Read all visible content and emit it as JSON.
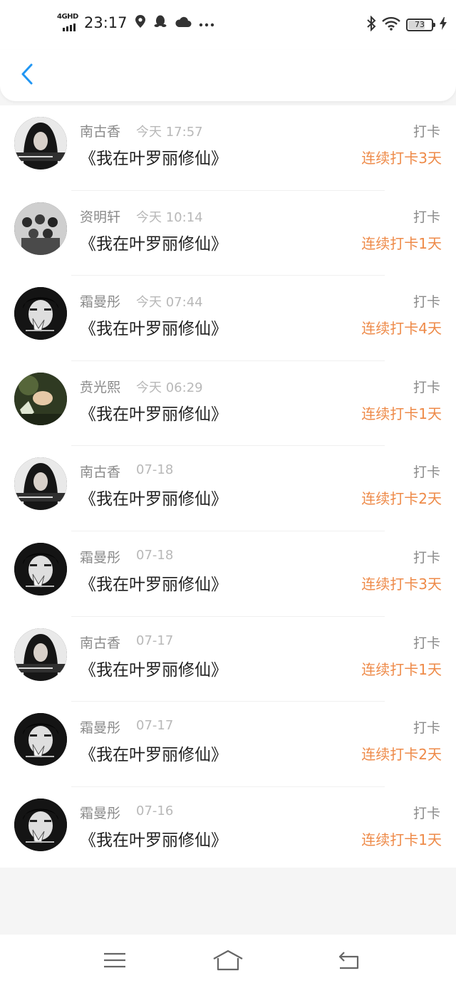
{
  "status_bar": {
    "network_label": "4GHD",
    "time": "23:17",
    "battery": "73",
    "battery_level_percent": 73,
    "icons": [
      "network-icon",
      "location-icon",
      "qq-icon",
      "cloud-icon",
      "more-dots-icon",
      "bluetooth-icon",
      "wifi-icon",
      "battery-icon",
      "charging-icon"
    ]
  },
  "header": {
    "back_icon": "chevron-left-icon",
    "accent_color": "#2196F3"
  },
  "feed": {
    "streak_color": "#EE8A48",
    "items": [
      {
        "name": "南古香",
        "time": "今天 17:57",
        "book": "《我在叶罗丽修仙》",
        "action": "打卡",
        "streak": "连续打卡3天",
        "avatar": "avatar-woman-dark-hair"
      },
      {
        "name": "资明轩",
        "time": "今天 10:14",
        "book": "《我在叶罗丽修仙》",
        "action": "打卡",
        "streak": "连续打卡1天",
        "avatar": "avatar-group-photo"
      },
      {
        "name": "霜曼彤",
        "time": "今天 07:44",
        "book": "《我在叶罗丽修仙》",
        "action": "打卡",
        "streak": "连续打卡4天",
        "avatar": "avatar-boy-bw"
      },
      {
        "name": "贲光熙",
        "time": "今天 06:29",
        "book": "《我在叶罗丽修仙》",
        "action": "打卡",
        "streak": "连续打卡1天",
        "avatar": "avatar-green-portrait"
      },
      {
        "name": "南古香",
        "time": "07-18",
        "book": "《我在叶罗丽修仙》",
        "action": "打卡",
        "streak": "连续打卡2天",
        "avatar": "avatar-woman-dark-hair"
      },
      {
        "name": "霜曼彤",
        "time": "07-18",
        "book": "《我在叶罗丽修仙》",
        "action": "打卡",
        "streak": "连续打卡3天",
        "avatar": "avatar-boy-bw"
      },
      {
        "name": "南古香",
        "time": "07-17",
        "book": "《我在叶罗丽修仙》",
        "action": "打卡",
        "streak": "连续打卡1天",
        "avatar": "avatar-woman-dark-hair"
      },
      {
        "name": "霜曼彤",
        "time": "07-17",
        "book": "《我在叶罗丽修仙》",
        "action": "打卡",
        "streak": "连续打卡2天",
        "avatar": "avatar-boy-bw"
      },
      {
        "name": "霜曼彤",
        "time": "07-16",
        "book": "《我在叶罗丽修仙》",
        "action": "打卡",
        "streak": "连续打卡1天",
        "avatar": "avatar-boy-bw"
      }
    ]
  },
  "bottom_nav": {
    "icons": [
      "menu-icon",
      "home-icon",
      "back-arrow-icon"
    ]
  }
}
